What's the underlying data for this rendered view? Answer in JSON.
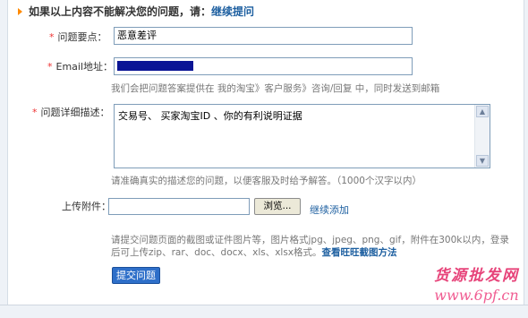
{
  "heading": {
    "text": "如果以上内容不能解决您的问题，请：",
    "link": "继续提问"
  },
  "form": {
    "required_mark": "*",
    "subject": {
      "label": "问题要点：",
      "value": "恶意差评"
    },
    "email": {
      "label": "Email地址：",
      "hint": "我们会把问题答案提供在 我的淘宝》客户服务》咨询/回复 中，同时发送到邮箱"
    },
    "detail": {
      "label": "问题详细描述：",
      "value": "交易号、 买家淘宝ID 、你的有利说明证据",
      "hint": "请准确真实的描述您的问题，以便客服及时给予解答。（1000个汉字以内）"
    },
    "upload": {
      "label": "上传附件：",
      "browse_label": "浏览...",
      "add_link": "继续添加",
      "hint_line1": "请提交问题页面的截图或证件图片等，图片格式jpg、jpeg、png、gif，附件在300k以内，登录",
      "hint_line2": "后可上传zip、rar、doc、docx、xls、xlsx格式。",
      "hint_link": "查看旺旺截图方法"
    },
    "submit_label": "提交问题"
  },
  "watermark": {
    "title": "货源批发网",
    "url": "www.6pf.cn"
  },
  "icons": {
    "scroll_up": "triangle-up",
    "scroll_down": "triangle-down"
  }
}
